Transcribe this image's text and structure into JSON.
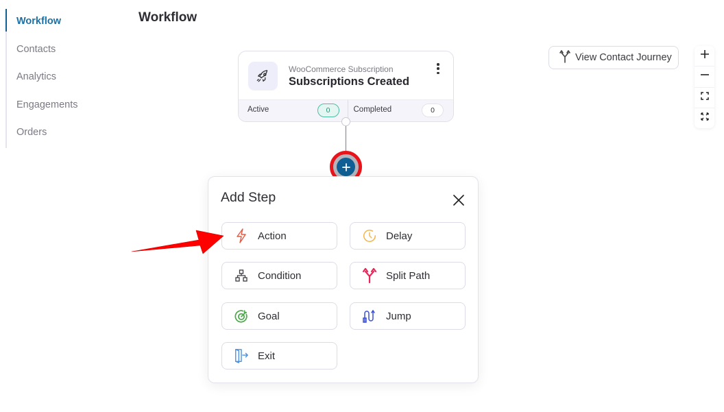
{
  "sidebar": {
    "items": [
      {
        "label": "Workflow",
        "active": true
      },
      {
        "label": "Contacts",
        "active": false
      },
      {
        "label": "Analytics",
        "active": false
      },
      {
        "label": "Engagements",
        "active": false
      },
      {
        "label": "Orders",
        "active": false
      }
    ]
  },
  "header": {
    "title": "Workflow"
  },
  "trigger": {
    "icon": "rocket-icon",
    "subtitle": "WooCommerce Subscription",
    "title": "Subscriptions Created",
    "menu_icon": "kebab-menu-icon",
    "stats": {
      "active_label": "Active",
      "active_value": "0",
      "completed_label": "Completed",
      "completed_value": "0"
    }
  },
  "add_node": {
    "icon": "plus-icon",
    "label": "+"
  },
  "toolbar": {
    "journey_button": {
      "label": "View Contact Journey",
      "icon": "split-branch-icon"
    },
    "zoom_controls": [
      {
        "name": "zoom-in",
        "icon": "plus-icon"
      },
      {
        "name": "zoom-out",
        "icon": "minus-icon"
      },
      {
        "name": "fit-view",
        "icon": "fit-frame-icon"
      },
      {
        "name": "fullscreen",
        "icon": "expand-icon"
      }
    ]
  },
  "popup": {
    "title": "Add Step",
    "close_icon": "close-icon",
    "steps": [
      {
        "label": "Action",
        "icon": "lightning-icon",
        "color": "#e45a43"
      },
      {
        "label": "Delay",
        "icon": "clock-icon",
        "color": "#f2b64b"
      },
      {
        "label": "Condition",
        "icon": "hierarchy-icon",
        "color": "#3a3a40"
      },
      {
        "label": "Split Path",
        "icon": "split-arrows-icon",
        "color": "#e8265a"
      },
      {
        "label": "Goal",
        "icon": "target-icon",
        "color": "#4caa4a"
      },
      {
        "label": "Jump",
        "icon": "jump-icon",
        "color": "#3a4ed8"
      },
      {
        "label": "Exit",
        "icon": "exit-door-icon",
        "color": "#4a8fe0"
      }
    ]
  },
  "annotation": {
    "arrow_color": "#ff0000",
    "highlight_ring_color": "#e8141b"
  }
}
